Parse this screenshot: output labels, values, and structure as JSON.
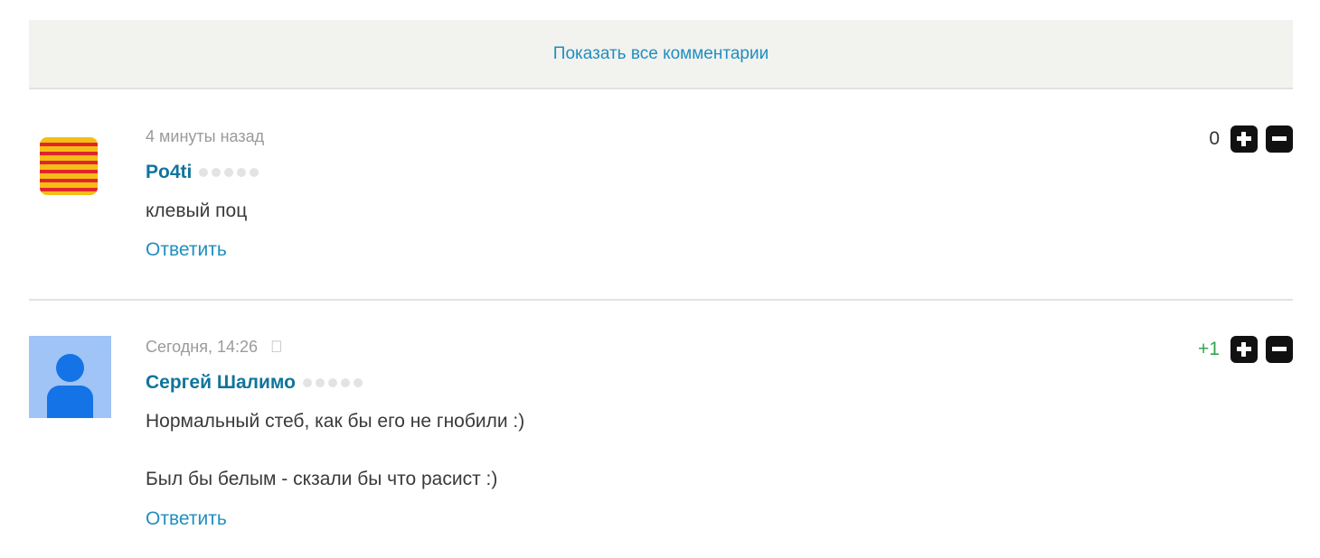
{
  "show_all": {
    "label": "Показать все комментарии"
  },
  "comments": [
    {
      "time": "4 минуты назад",
      "author": "Po4ti",
      "text_lines": [
        "клевый поц"
      ],
      "reply_label": "Ответить",
      "score": "0",
      "avatar": "flag-avatar"
    },
    {
      "time": "Сегодня, 14:26",
      "device_icon": "apple-icon",
      "author": "Сергей Шалимо",
      "text_lines": [
        "Нормальный стеб, как бы его не гнобили :)",
        "Был бы белым - скзали бы что расист :)"
      ],
      "reply_label": "Ответить",
      "score": "+1",
      "avatar": "default-user-avatar"
    }
  ],
  "colors": {
    "link": "#1f8fbf",
    "author": "#11749c",
    "positive_score": "#2fa84f",
    "panel_bg": "#f2f2ef"
  }
}
